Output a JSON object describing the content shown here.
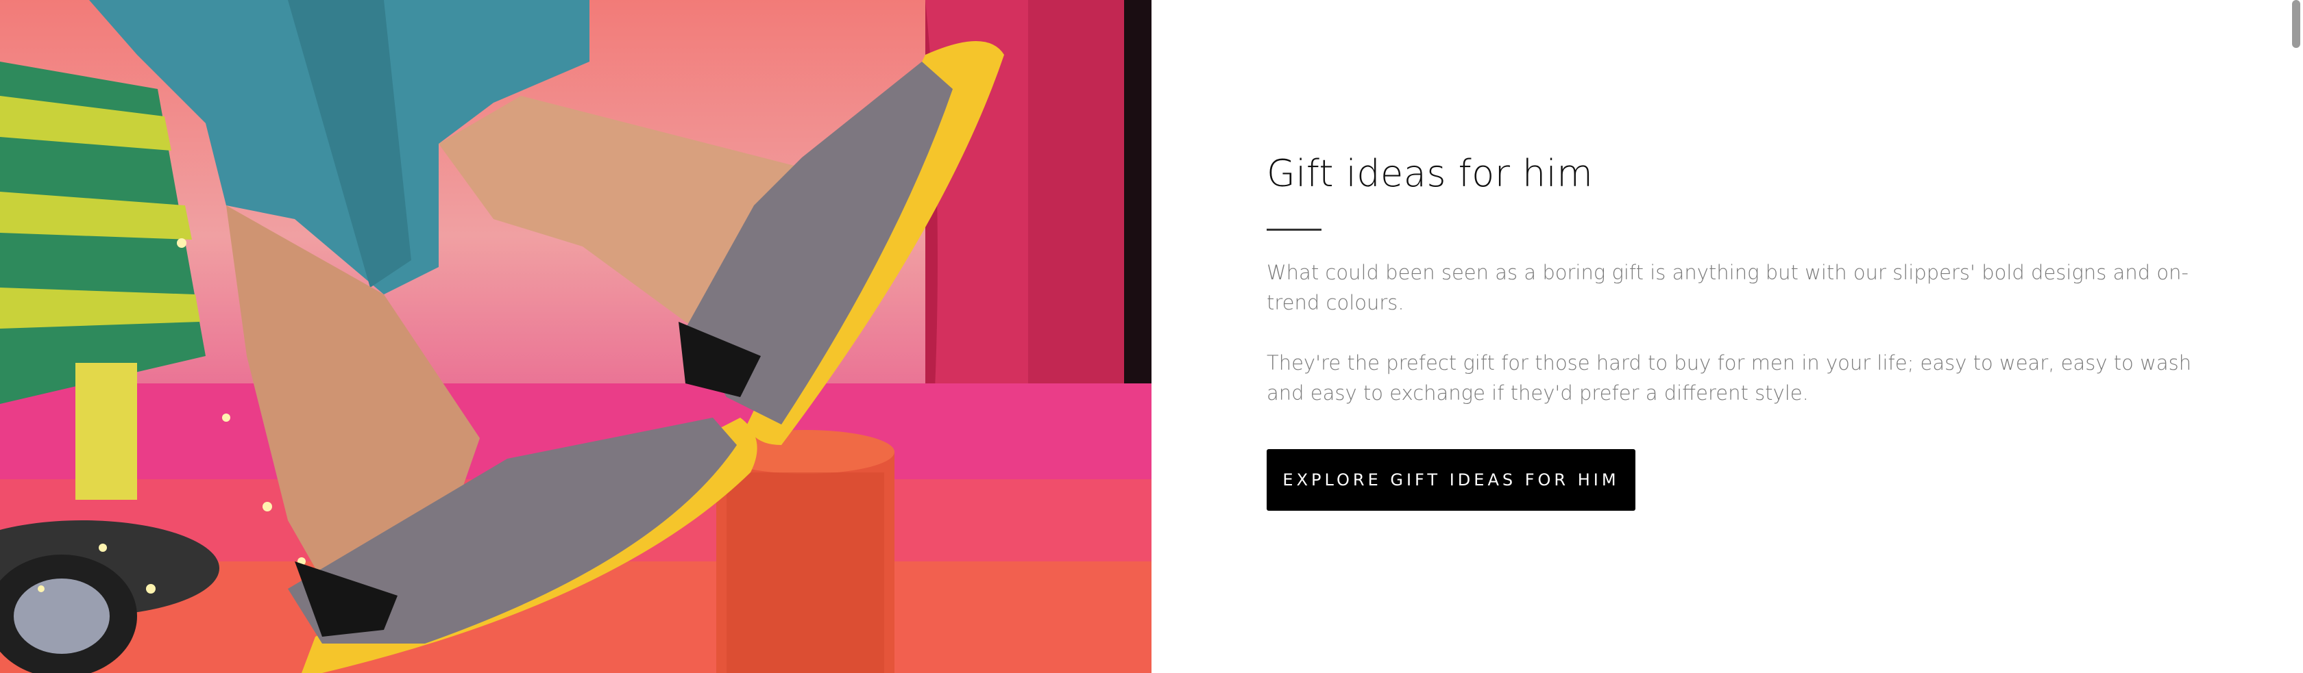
{
  "hero_image": {
    "subject": "man-wearing-grey-felt-slippers-with-yellow-soles"
  },
  "section": {
    "heading": "Gift ideas for him",
    "paragraphs": [
      "What could been seen as a boring gift is anything but with our slippers' bold designs and on-trend colours.",
      "They're the prefect gift for those hard to buy for men in your life; easy to wear, easy to wash and easy to exchange if they'd prefer a different style."
    ],
    "cta_label": "Explore gift ideas for him"
  },
  "colors": {
    "accent": "#000000",
    "body_text": "#7a7a7a",
    "heading_text": "#111111",
    "slipper_felt": "#7d7780",
    "slipper_sole": "#f5c52b",
    "trousers": "#3f8fa0"
  }
}
